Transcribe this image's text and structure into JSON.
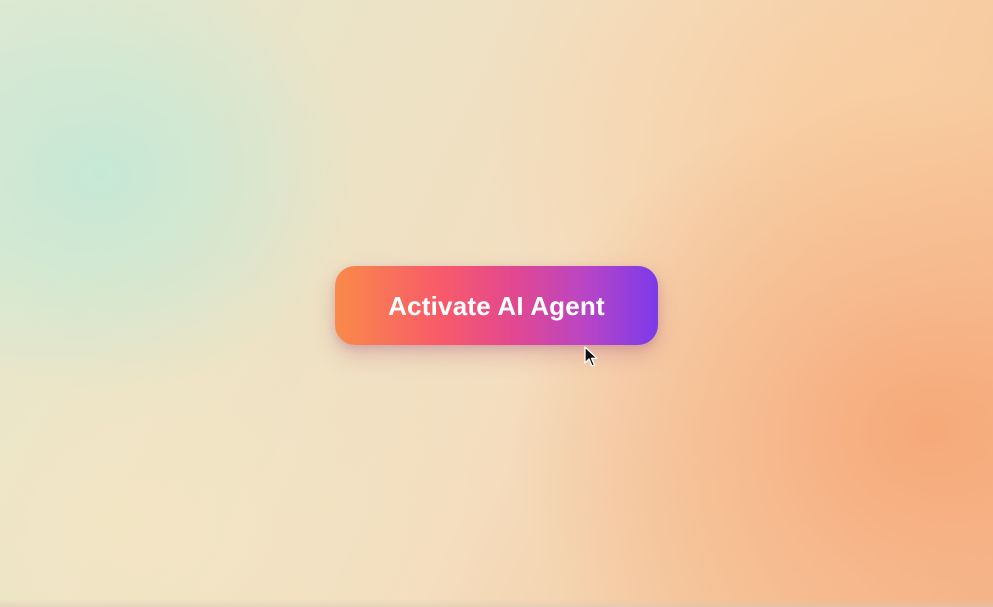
{
  "button": {
    "label": "Activate AI Agent"
  },
  "colors": {
    "button_gradient": [
      "#f98a4a",
      "#f85a6a",
      "#e2488f",
      "#b845c6",
      "#7b3aea"
    ],
    "button_text": "#ffffff",
    "background_mint": "#c4e9d6",
    "background_cream": "#f1dfc2",
    "background_peach": "#f4b88e"
  },
  "icons": {
    "cursor": "mouse-pointer-icon"
  }
}
